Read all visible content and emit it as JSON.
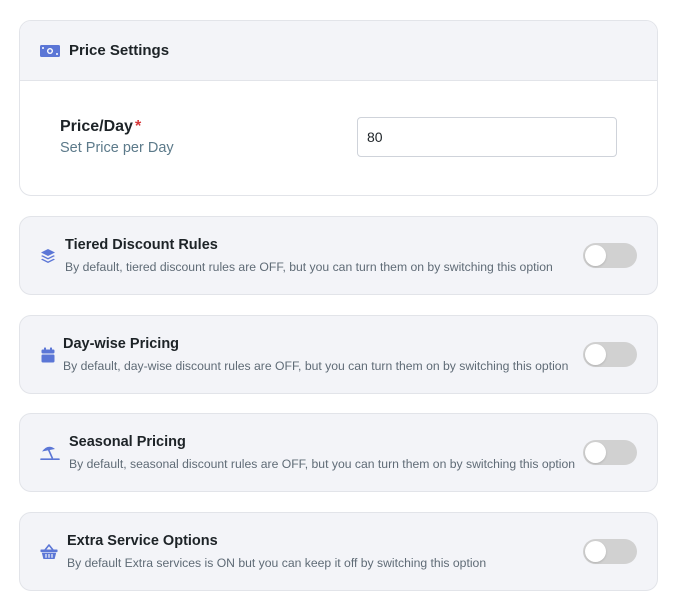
{
  "colors": {
    "accent": "#5b76d6",
    "card_bg": "#f3f4f8",
    "toggle_off": "#d1d1d1",
    "required": "#d63638"
  },
  "price_settings": {
    "title": "Price Settings",
    "icon": "money-bill-icon",
    "field_label": "Price/Day",
    "required_mark": "*",
    "field_sub": "Set Price per Day",
    "price_value": "80"
  },
  "options": [
    {
      "title": "Tiered Discount Rules",
      "description": "By default, tiered discount rules are OFF, but you can turn them on by switching this option",
      "icon": "layers-icon",
      "enabled": false
    },
    {
      "title": "Day-wise Pricing",
      "description": "By default, day-wise discount rules are OFF, but you can turn them on by switching this option",
      "icon": "calendar-icon",
      "enabled": false
    },
    {
      "title": "Seasonal Pricing",
      "description": "By default, seasonal discount rules are OFF, but you can turn them on by switching this option",
      "icon": "beach-umbrella-icon",
      "enabled": false
    },
    {
      "title": "Extra Service Options",
      "description": "By default Extra services is ON but you can keep it off by switching this option",
      "icon": "basket-icon",
      "enabled": false
    }
  ]
}
